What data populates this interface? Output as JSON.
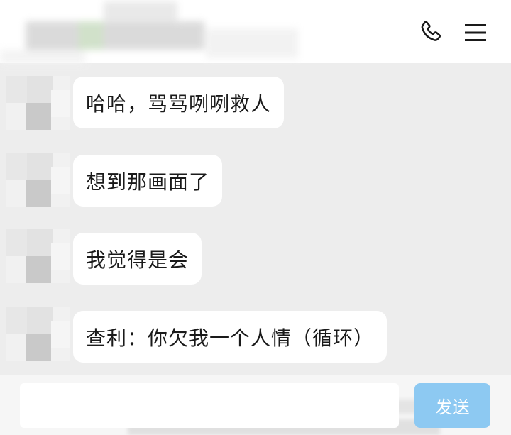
{
  "header": {
    "call_icon": "phone-icon",
    "menu_icon": "menu-icon"
  },
  "messages": [
    {
      "text": "哈哈，骂骂咧咧救人"
    },
    {
      "text": "想到那画面了"
    },
    {
      "text": "我觉得是会"
    },
    {
      "text": "查利：你欠我一个人情（循环）"
    }
  ],
  "composer": {
    "input_value": "",
    "send_label": "发送"
  },
  "colors": {
    "background": "#ededed",
    "bubble": "#ffffff",
    "send_button": "#8dc9f2"
  }
}
